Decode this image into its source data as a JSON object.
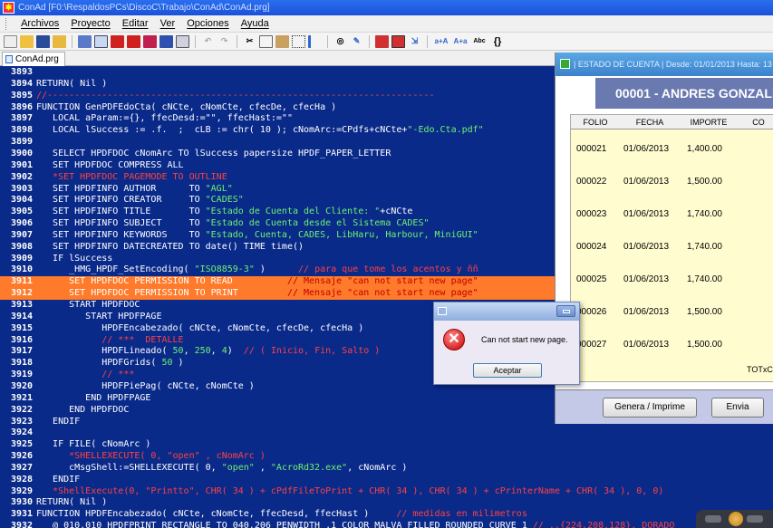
{
  "window": {
    "title": "ConAd [F0:\\RespaldosPCs\\DiscoC\\Trabajo\\ConAd\\ConAd.prg]"
  },
  "menu": [
    "Archivos",
    "Proyecto",
    "Editar",
    "Ver",
    "Opciones",
    "Ayuda"
  ],
  "toolbar": {
    "icons": [
      "new-icon",
      "open-icon",
      "save-icon",
      "folder-icon",
      "build-icon",
      "run-icon",
      "stop-icon",
      "debug-icon",
      "breakpoint-icon",
      "window-icon",
      "undo-icon",
      "redo-icon",
      "cut-icon",
      "copy-icon",
      "paste-icon",
      "select-icon",
      "indent-icon",
      "find-icon",
      "replace-icon",
      "eraser-icon",
      "bookmark-icon",
      "goto-icon",
      "font-bigger-icon",
      "font-smaller-icon",
      "spell-icon",
      "braces-icon"
    ],
    "labels": {
      "font_bigger": "a+A",
      "font_smaller": "A+a",
      "spell": "Abc",
      "braces": "{}"
    }
  },
  "tab": {
    "label": "ConAd.prg"
  },
  "editor": {
    "lines": [
      {
        "n": "3893",
        "segs": []
      },
      {
        "n": "3894",
        "segs": [
          {
            "t": "RETURN( Nil )",
            "c": "cw"
          }
        ]
      },
      {
        "n": "3895",
        "segs": [
          {
            "t": "//-----------------------------------------------------------------------",
            "c": "cr"
          }
        ]
      },
      {
        "n": "3896",
        "segs": [
          {
            "t": "FUNCTION GenPDFEdoCta( cNCte, cNomCte, cfecDe, cfecHa )",
            "c": "cw"
          }
        ]
      },
      {
        "n": "3897",
        "segs": [
          {
            "t": "   LOCAL aParam:={}, ffecDesd:=\"\", ffecHast:=\"\"",
            "c": "cw"
          }
        ]
      },
      {
        "n": "3898",
        "segs": [
          {
            "t": "   LOCAL lSuccess := .f.  ;  cLB := chr( 10 ); cNomArc:=CPdfs+cNCte+",
            "c": "cw"
          },
          {
            "t": "\"-Edo.Cta.pdf\"",
            "c": "cg"
          }
        ]
      },
      {
        "n": "3899",
        "segs": []
      },
      {
        "n": "3900",
        "segs": [
          {
            "t": "   SELECT HPDFDOC cNomArc TO lSuccess papersize HPDF_PAPER_LETTER",
            "c": "cw"
          }
        ]
      },
      {
        "n": "3901",
        "segs": [
          {
            "t": "   SET HPDFDOC COMPRESS ALL",
            "c": "cw"
          }
        ]
      },
      {
        "n": "3902",
        "segs": [
          {
            "t": "   *SET HPDFDOC PAGEMODE TO OUTLINE",
            "c": "cr"
          }
        ]
      },
      {
        "n": "3903",
        "segs": [
          {
            "t": "   SET HPDFINFO AUTHOR      TO ",
            "c": "cw"
          },
          {
            "t": "\"AGL\"",
            "c": "cg"
          }
        ]
      },
      {
        "n": "3904",
        "segs": [
          {
            "t": "   SET HPDFINFO CREATOR     TO ",
            "c": "cw"
          },
          {
            "t": "\"CADES\"",
            "c": "cg"
          }
        ]
      },
      {
        "n": "3905",
        "segs": [
          {
            "t": "   SET HPDFINFO TITLE       TO ",
            "c": "cw"
          },
          {
            "t": "\"Estado de Cuenta del Cliente: \"",
            "c": "cg"
          },
          {
            "t": "+cNCte",
            "c": "cw"
          }
        ]
      },
      {
        "n": "3906",
        "segs": [
          {
            "t": "   SET HPDFINFO SUBJECT     TO ",
            "c": "cw"
          },
          {
            "t": "\"Estado de Cuenta desde el Sistema CADES\"",
            "c": "cg"
          }
        ]
      },
      {
        "n": "3907",
        "segs": [
          {
            "t": "   SET HPDFINFO KEYWORDS    TO ",
            "c": "cw"
          },
          {
            "t": "\"Estado, Cuenta, CADES, LibHaru, Harbour, MiniGUI\"",
            "c": "cg"
          }
        ]
      },
      {
        "n": "3908",
        "segs": [
          {
            "t": "   SET HPDFINFO DATECREATED TO date() TIME time()",
            "c": "cw"
          }
        ]
      },
      {
        "n": "3909",
        "segs": [
          {
            "t": "   IF lSuccess",
            "c": "cw"
          }
        ]
      },
      {
        "n": "3910",
        "segs": [
          {
            "t": "      _HMG_HPDF_SetEncoding( ",
            "c": "cw"
          },
          {
            "t": "\"ISO8859-3\"",
            "c": "cg"
          },
          {
            "t": " )      ",
            "c": "cw"
          },
          {
            "t": "// para que tome los acentos y ññ",
            "c": "cr"
          }
        ]
      },
      {
        "n": "3911",
        "hl": true,
        "segs": [
          {
            "t": "      SET HPDFDOC PERMISSION TO READ          ",
            "c": "cw"
          },
          {
            "t": "// Mensaje \"can not start new page\"",
            "c": "cr"
          }
        ]
      },
      {
        "n": "3912",
        "hl": true,
        "segs": [
          {
            "t": "      SET HPDFDOC PERMISSION TO PRINT         ",
            "c": "cw"
          },
          {
            "t": "// Mensaje \"can not start new page\"",
            "c": "cr"
          }
        ]
      },
      {
        "n": "3913",
        "segs": [
          {
            "t": "      START HPDFDOC",
            "c": "cw"
          }
        ]
      },
      {
        "n": "3914",
        "segs": [
          {
            "t": "         START HPDFPAGE",
            "c": "cw"
          }
        ]
      },
      {
        "n": "3915",
        "segs": [
          {
            "t": "            HPDFEncabezado( cNCte, cNomCte, cfecDe, cfecHa )",
            "c": "cw"
          }
        ]
      },
      {
        "n": "3916",
        "segs": [
          {
            "t": "            // ***  DETALLE",
            "c": "cr"
          }
        ]
      },
      {
        "n": "3917",
        "segs": [
          {
            "t": "            HPDFLineado( ",
            "c": "cw"
          },
          {
            "t": "50",
            "c": "cg"
          },
          {
            "t": ", ",
            "c": "cw"
          },
          {
            "t": "250",
            "c": "cg"
          },
          {
            "t": ", ",
            "c": "cw"
          },
          {
            "t": "4",
            "c": "cg"
          },
          {
            "t": ")  ",
            "c": "cw"
          },
          {
            "t": "// ( Inicio, Fin, Salto )",
            "c": "cr"
          }
        ]
      },
      {
        "n": "3918",
        "segs": [
          {
            "t": "            HPDFGrids( ",
            "c": "cw"
          },
          {
            "t": "50",
            "c": "cg"
          },
          {
            "t": " )",
            "c": "cw"
          }
        ]
      },
      {
        "n": "3919",
        "segs": [
          {
            "t": "            // ***",
            "c": "cr"
          }
        ]
      },
      {
        "n": "3920",
        "segs": [
          {
            "t": "            HPDFPiePag( cNCte, cNomCte )",
            "c": "cw"
          }
        ]
      },
      {
        "n": "3921",
        "segs": [
          {
            "t": "         END HPDFPAGE",
            "c": "cw"
          }
        ]
      },
      {
        "n": "3922",
        "segs": [
          {
            "t": "      END HPDFDOC",
            "c": "cw"
          }
        ]
      },
      {
        "n": "3923",
        "segs": [
          {
            "t": "   ENDIF",
            "c": "cw"
          }
        ]
      },
      {
        "n": "3924",
        "segs": []
      },
      {
        "n": "3925",
        "segs": [
          {
            "t": "   IF FILE( cNomArc )",
            "c": "cw"
          }
        ]
      },
      {
        "n": "3926",
        "segs": [
          {
            "t": "      *SHELLEXECUTE( 0, \"open\" , cNomArc )",
            "c": "cr"
          }
        ]
      },
      {
        "n": "3927",
        "segs": [
          {
            "t": "      cMsgShell:=SHELLEXECUTE( 0, ",
            "c": "cw"
          },
          {
            "t": "\"open\"",
            "c": "cg"
          },
          {
            "t": " , ",
            "c": "cw"
          },
          {
            "t": "\"AcroRd32.exe\"",
            "c": "cg"
          },
          {
            "t": ", cNomArc )",
            "c": "cw"
          }
        ]
      },
      {
        "n": "3928",
        "segs": [
          {
            "t": "   ENDIF",
            "c": "cw"
          }
        ]
      },
      {
        "n": "3929",
        "segs": [
          {
            "t": "   *ShellExecute(0, \"Printto\", CHR( 34 ) + cPdfFileToPrint + CHR( 34 ), CHR( 34 ) + cPrinterName + CHR( 34 ), 0, 0)",
            "c": "cr"
          }
        ]
      },
      {
        "n": "3930",
        "segs": [
          {
            "t": "RETURN( Nil )",
            "c": "cw"
          }
        ]
      },
      {
        "n": "3931",
        "segs": [
          {
            "t": "FUNCTION HPDFEncabezado( cNCte, cNomCte, ffecDesd, ffecHast )     ",
            "c": "cw"
          },
          {
            "t": "// medidas en milimetros",
            "c": "cr"
          }
        ]
      },
      {
        "n": "3932",
        "segs": [
          {
            "t": "   @ 010,010 HPDFPRINT RECTANGLE TO 040,206 PENWIDTH .1 COLOR MALVA FILLED ROUNDED CURVE 1 ",
            "c": "cw"
          },
          {
            "t": "// ..{224,208,128}, DORADO",
            "c": "cr"
          }
        ]
      }
    ]
  },
  "panel": {
    "title": "| ESTADO DE CUENTA |  Desde: 01/01/2013  Hasta: 13",
    "customer": "00001 - ANDRES GONZALEZ",
    "columns": [
      "FOLIO",
      "FECHA",
      "IMPORTE",
      "CO"
    ],
    "rows": [
      {
        "folio": "000021",
        "fecha": "01/06/2013",
        "importe": "1,400.00"
      },
      {
        "folio": "000022",
        "fecha": "01/06/2013",
        "importe": "1,500.00"
      },
      {
        "folio": "000023",
        "fecha": "01/06/2013",
        "importe": "1,740.00"
      },
      {
        "folio": "000024",
        "fecha": "01/06/2013",
        "importe": "1,740.00"
      },
      {
        "folio": "000025",
        "fecha": "01/06/2013",
        "importe": "1,740.00"
      },
      {
        "folio": "000026",
        "fecha": "01/06/2013",
        "importe": "1,500.00"
      },
      {
        "folio": "000027",
        "fecha": "01/06/2013",
        "importe": "1,500.00"
      }
    ],
    "total_label": "TOTxC",
    "buttons": {
      "generate": "Genera / Imprime",
      "send": "Envia"
    }
  },
  "dialog": {
    "message": "Can not start new page.",
    "ok": "Aceptar"
  }
}
